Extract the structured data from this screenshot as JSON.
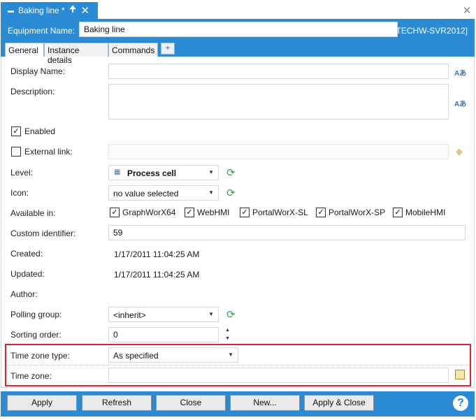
{
  "doc_tab": {
    "title": "Baking line *",
    "pin_glyph": "🠉",
    "close_glyph": "✕"
  },
  "window": {
    "close_glyph": "✕"
  },
  "header": {
    "equipment_label": "Equipment Name:",
    "equipment_value": "Baking line",
    "server": "[TECHW-SVR2012]"
  },
  "tabs": {
    "general": "General",
    "instance_details": "Instance details",
    "commands": "Commands",
    "add": "+"
  },
  "form": {
    "display_name_label": "Display Name:",
    "description_label": "Description:",
    "lang_glyph": "Aあ",
    "enabled_label": "Enabled",
    "enabled_checked": true,
    "external_link_label": "External link:",
    "external_link_checked": false,
    "level_label": "Level:",
    "level_value": "Process cell",
    "icon_label": "Icon:",
    "icon_value": "no value selected",
    "available_label": "Available in:",
    "available": [
      {
        "name": "GraphWorX64",
        "checked": true
      },
      {
        "name": "WebHMI",
        "checked": true
      },
      {
        "name": "PortalWorX-SL",
        "checked": true
      },
      {
        "name": "PortalWorX-SP",
        "checked": true
      },
      {
        "name": "MobileHMI",
        "checked": true
      }
    ],
    "custom_id_label": "Custom identifier:",
    "custom_id_value": "59",
    "created_label": "Created:",
    "created_value": "1/17/2011 11:04:25 AM",
    "updated_label": "Updated:",
    "updated_value": "1/17/2011 11:04:25 AM",
    "author_label": "Author:",
    "polling_label": "Polling group:",
    "polling_value": "<inherit>",
    "sorting_label": "Sorting order:",
    "sorting_value": "0",
    "tz_type_label": "Time zone type:",
    "tz_type_value": "As specified",
    "tz_label": "Time zone:",
    "tz_value": ""
  },
  "glyphs": {
    "check": "✓",
    "arrow_down": "▼",
    "arrow_up": "▲",
    "refresh": "⟳",
    "help": "?"
  },
  "footer": {
    "apply": "Apply",
    "refresh": "Refresh",
    "close": "Close",
    "new": "New...",
    "apply_close": "Apply & Close"
  },
  "colors": {
    "accent": "#2a8ad4",
    "highlight": "#d9252e"
  }
}
